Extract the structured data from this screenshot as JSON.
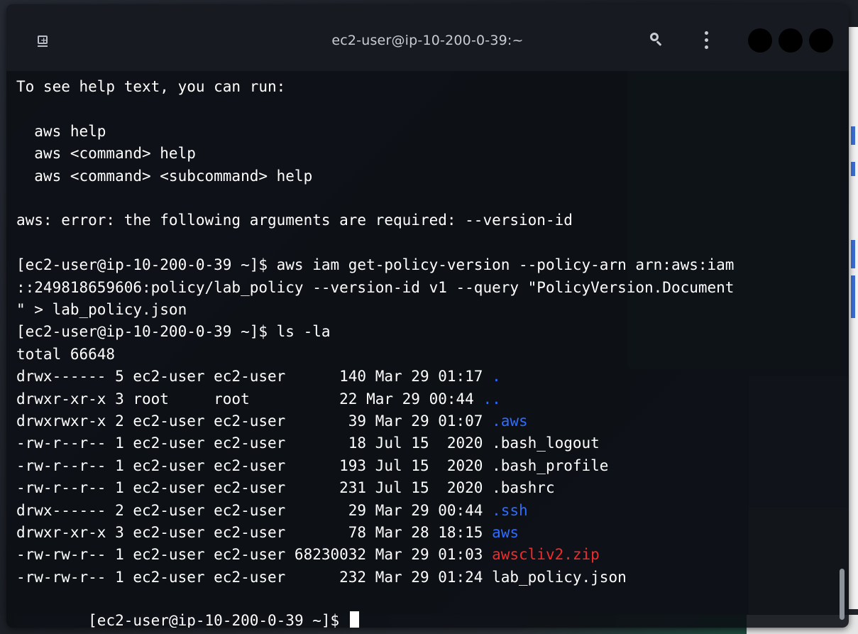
{
  "window": {
    "title": "ec2-user@ip-10-200-0-39:~"
  },
  "icons": {
    "new_tab": "new-tab-icon",
    "search": "search-icon",
    "menu": "kebab-menu-icon"
  },
  "colors": {
    "dir": "#2f6bff",
    "archive": "#ef2b2b",
    "text": "#ffffff",
    "background": "#0c0f15"
  },
  "terminal": {
    "lines": [
      {
        "text": "To see help text, you can run:"
      },
      {
        "text": ""
      },
      {
        "text": "  aws help"
      },
      {
        "text": "  aws <command> help"
      },
      {
        "text": "  aws <command> <subcommand> help"
      },
      {
        "text": ""
      },
      {
        "text": "aws: error: the following arguments are required: --version-id"
      },
      {
        "text": ""
      },
      {
        "text": "[ec2-user@ip-10-200-0-39 ~]$ aws iam get-policy-version --policy-arn arn:aws:iam"
      },
      {
        "text": "::249818659606:policy/lab_policy --version-id v1 --query \"PolicyVersion.Document"
      },
      {
        "text": "\" > lab_policy.json"
      },
      {
        "text": "[ec2-user@ip-10-200-0-39 ~]$ ls -la"
      },
      {
        "text": "total 66648"
      },
      {
        "text": "drwx------ 5 ec2-user ec2-user      140 Mar 29 01:17 ",
        "name": ".",
        "kind": "dir"
      },
      {
        "text": "drwxr-xr-x 3 root     root          22 Mar 29 00:44 ",
        "name": "..",
        "kind": "dir"
      },
      {
        "text": "drwxrwxr-x 2 ec2-user ec2-user       39 Mar 29 01:07 ",
        "name": ".aws",
        "kind": "dir"
      },
      {
        "text": "-rw-r--r-- 1 ec2-user ec2-user       18 Jul 15  2020 ",
        "name": ".bash_logout",
        "kind": "file"
      },
      {
        "text": "-rw-r--r-- 1 ec2-user ec2-user      193 Jul 15  2020 ",
        "name": ".bash_profile",
        "kind": "file"
      },
      {
        "text": "-rw-r--r-- 1 ec2-user ec2-user      231 Jul 15  2020 ",
        "name": ".bashrc",
        "kind": "file"
      },
      {
        "text": "drwx------ 2 ec2-user ec2-user       29 Mar 29 00:44 ",
        "name": ".ssh",
        "kind": "dir"
      },
      {
        "text": "drwxr-xr-x 3 ec2-user ec2-user       78 Mar 28 18:15 ",
        "name": "aws",
        "kind": "dir"
      },
      {
        "text": "-rw-rw-r-- 1 ec2-user ec2-user 68230032 Mar 29 01:03 ",
        "name": "awscliv2.zip",
        "kind": "archive"
      },
      {
        "text": "-rw-rw-r-- 1 ec2-user ec2-user      232 Mar 29 01:24 ",
        "name": "lab_policy.json",
        "kind": "file"
      }
    ],
    "prompt": "[ec2-user@ip-10-200-0-39 ~]$ "
  }
}
